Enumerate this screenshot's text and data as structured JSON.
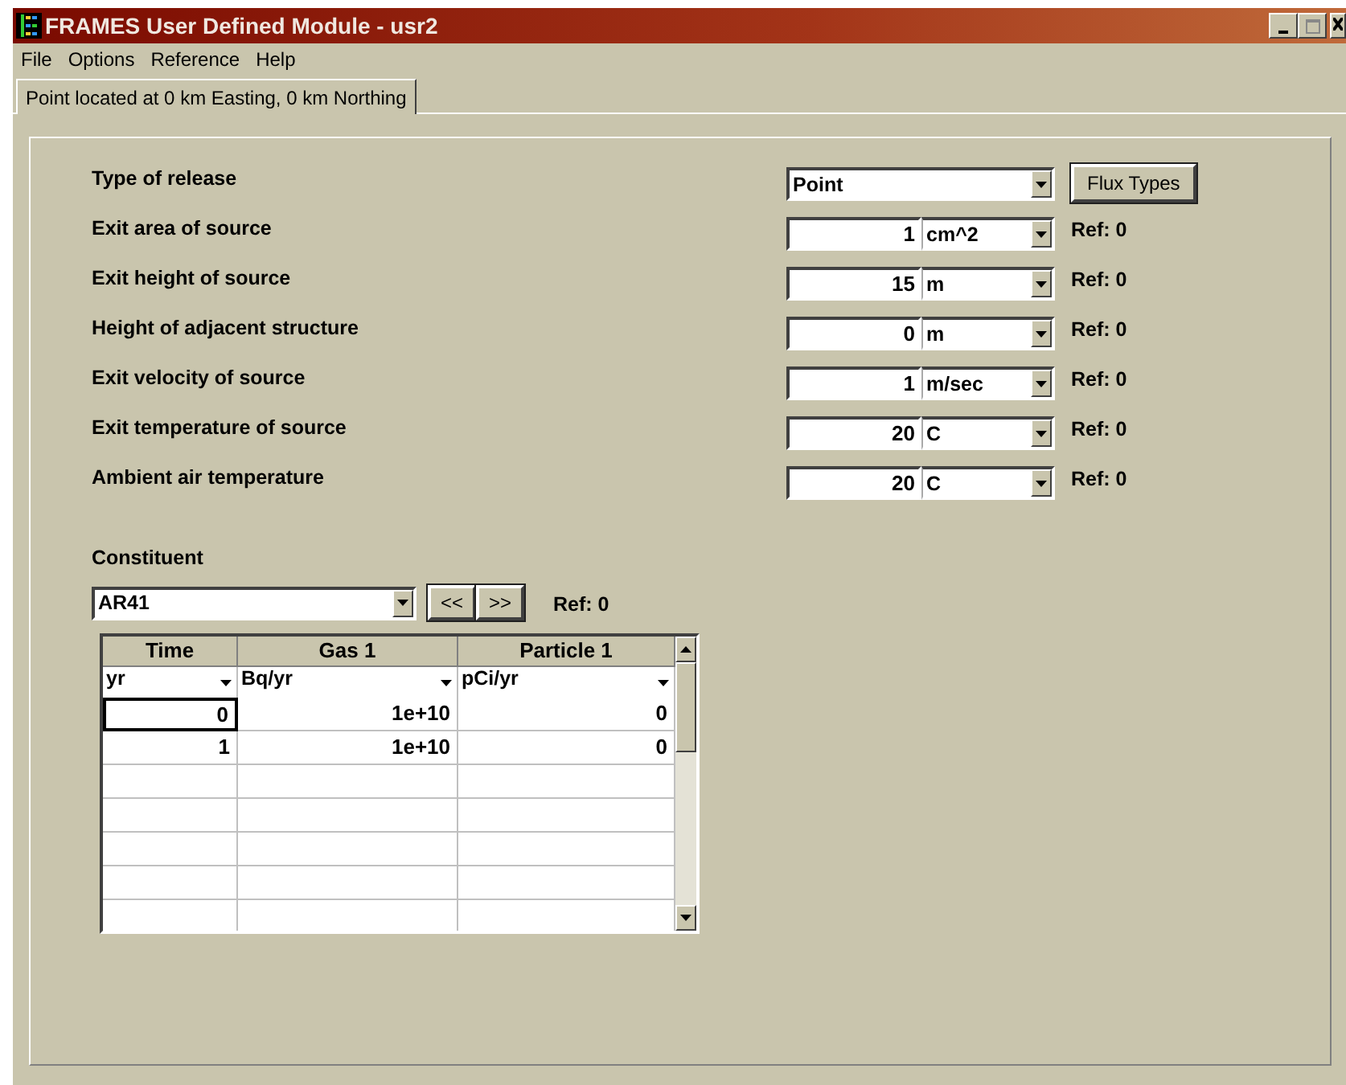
{
  "window": {
    "title": "FRAMES User Defined Module - usr2"
  },
  "menu": [
    "File",
    "Options",
    "Reference",
    "Help"
  ],
  "tabs": [
    {
      "label": "Point located at 0 km Easting, 0 km Northing",
      "selected": true
    }
  ],
  "release": {
    "label": "Type of release",
    "value": "Point",
    "button": "Flux Types"
  },
  "parameters": [
    {
      "label": "Exit area of source",
      "value": "1",
      "unit": "cm^2",
      "ref": "Ref: 0"
    },
    {
      "label": "Exit height of source",
      "value": "15",
      "unit": "m",
      "ref": "Ref: 0"
    },
    {
      "label": "Height of adjacent structure",
      "value": "0",
      "unit": "m",
      "ref": "Ref: 0"
    },
    {
      "label": "Exit velocity of source",
      "value": "1",
      "unit": "m/sec",
      "ref": "Ref: 0"
    },
    {
      "label": "Exit temperature of source",
      "value": "20",
      "unit": "C",
      "ref": "Ref: 0"
    },
    {
      "label": "Ambient air temperature",
      "value": "20",
      "unit": "C",
      "ref": "Ref: 0"
    }
  ],
  "constituent": {
    "label": "Constituent",
    "value": "AR41",
    "prev": "<<",
    "next": ">>",
    "ref": "Ref:  0"
  },
  "table": {
    "columns": [
      {
        "header": "Time",
        "unit": "yr"
      },
      {
        "header": "Gas 1",
        "unit": "Bq/yr"
      },
      {
        "header": "Particle 1",
        "unit": "pCi/yr"
      }
    ],
    "rows": [
      {
        "cells": [
          "0",
          "1e+10",
          "0"
        ],
        "selected": true
      },
      {
        "cells": [
          "1",
          "1e+10",
          "0"
        ],
        "selected": false
      }
    ]
  }
}
